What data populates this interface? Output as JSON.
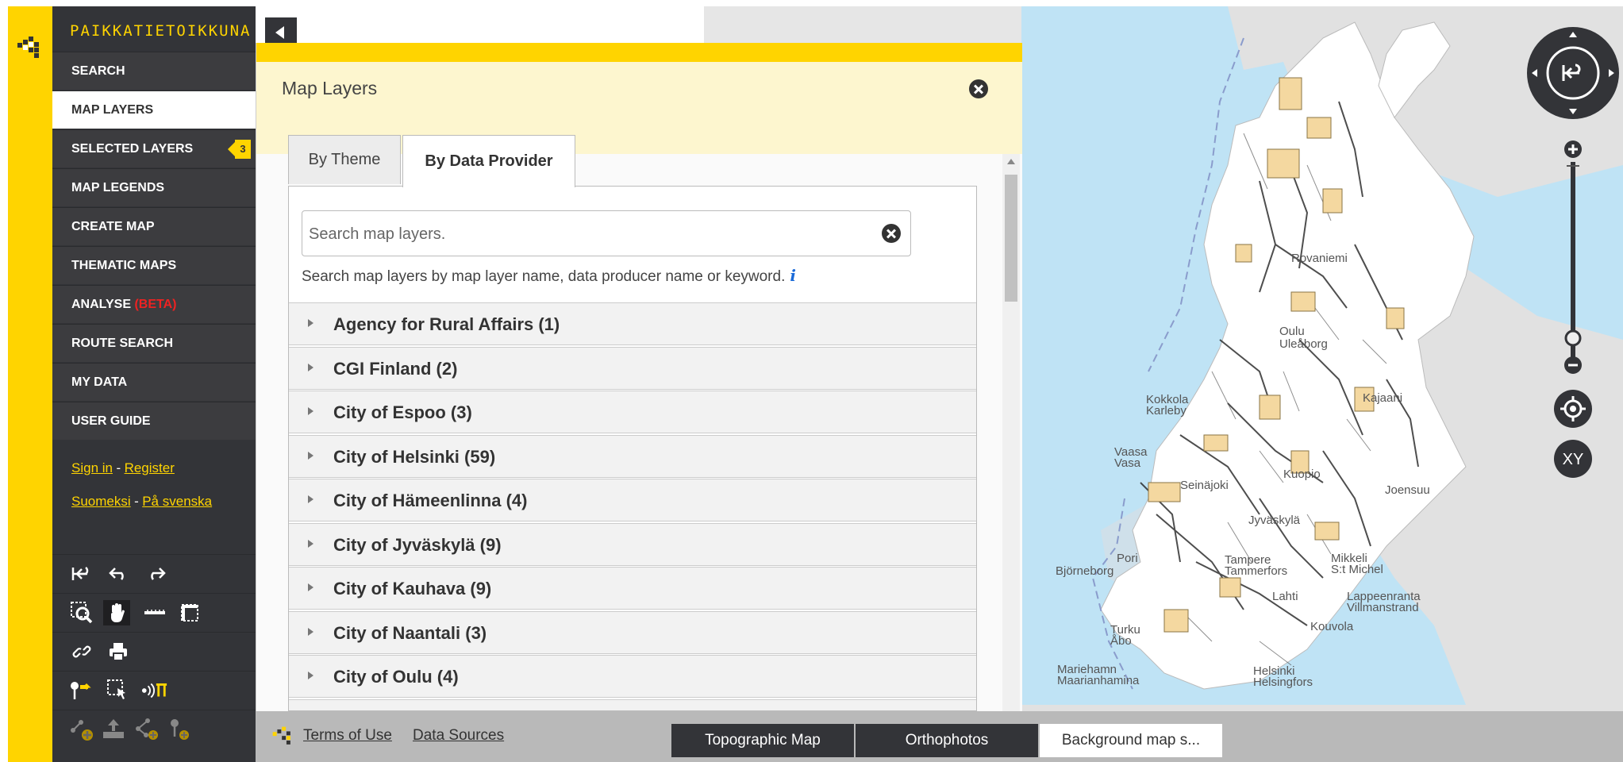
{
  "brand": "PAIKKATIETOIKKUNA",
  "nav": {
    "items": [
      {
        "label": "SEARCH"
      },
      {
        "label": "MAP LAYERS"
      },
      {
        "label": "SELECTED LAYERS",
        "badge": "3"
      },
      {
        "label": "MAP LEGENDS"
      },
      {
        "label": "CREATE MAP"
      },
      {
        "label": "THEMATIC MAPS"
      },
      {
        "label": "ANALYSE",
        "suffix": "(BETA)"
      },
      {
        "label": "ROUTE SEARCH"
      },
      {
        "label": "MY DATA"
      },
      {
        "label": "USER GUIDE"
      }
    ],
    "active_index": 1,
    "sign_in": "Sign in",
    "register": "Register",
    "dash": "-",
    "lang_fi": "Suomeksi",
    "lang_sv": "På svenska"
  },
  "panel": {
    "title": "Map Layers",
    "tabs": [
      {
        "label": "By Theme"
      },
      {
        "label": "By Data Provider"
      }
    ],
    "active_tab": 1,
    "search_placeholder": "Search map layers.",
    "search_hint": "Search map layers by map layer name, data producer name or keyword.",
    "info_glyph": "i",
    "groups": [
      {
        "label": "Agency for Rural Affairs (1)"
      },
      {
        "label": "CGI Finland (2)"
      },
      {
        "label": "City of Espoo (3)"
      },
      {
        "label": "City of Helsinki (59)"
      },
      {
        "label": "City of Hämeenlinna (4)"
      },
      {
        "label": "City of Jyväskylä (9)"
      },
      {
        "label": "City of Kauhava (9)"
      },
      {
        "label": "City of Naantali (3)"
      },
      {
        "label": "City of Oulu (4)"
      }
    ]
  },
  "map": {
    "places": [
      {
        "label": "Oulu"
      },
      {
        "label": "Uleåborg"
      },
      {
        "label": "Kokkola"
      },
      {
        "label": "Karleby"
      },
      {
        "label": "Kajaani"
      },
      {
        "label": "Vaasa"
      },
      {
        "label": "Vasa"
      },
      {
        "label": "Pori"
      },
      {
        "label": "Björneborg"
      },
      {
        "label": "Tampere"
      },
      {
        "label": "Tammerfors"
      },
      {
        "label": "Mikkeli"
      },
      {
        "label": "S:t Michel"
      },
      {
        "label": "Lappeenranta"
      },
      {
        "label": "Villmanstrand"
      },
      {
        "label": "Turku"
      },
      {
        "label": "Åbo"
      },
      {
        "label": "Mariehamn"
      },
      {
        "label": "Maarianhamina"
      },
      {
        "label": "Helsinki"
      },
      {
        "label": "Helsingfors"
      },
      {
        "label": "Kuopio"
      },
      {
        "label": "Joensuu"
      },
      {
        "label": "Jyväskylä"
      },
      {
        "label": "Seinäjoki"
      },
      {
        "label": "Lahti"
      },
      {
        "label": "Kouvola"
      },
      {
        "label": "Rovaniemi"
      }
    ],
    "xy_label": "XY",
    "colors": {
      "sea": "#bfe3f5",
      "land": "#ffffff",
      "neighbor": "#dcdcdc",
      "feature": "#f4d8a0",
      "lines": "#222222"
    }
  },
  "footer": {
    "terms": "Terms of Use",
    "sources": "Data Sources",
    "basemaps": [
      {
        "label": "Topographic Map"
      },
      {
        "label": "Orthophotos"
      },
      {
        "label": "Background map s..."
      }
    ]
  }
}
